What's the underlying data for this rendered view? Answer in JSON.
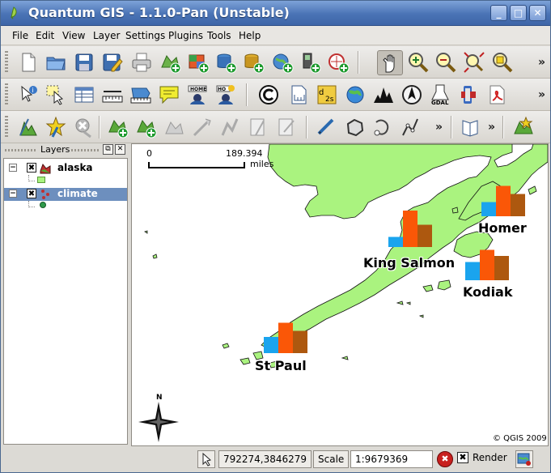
{
  "window": {
    "title": "Quantum GIS - 1.1.0-Pan (Unstable)",
    "minimize_glyph": "_",
    "maximize_glyph": "□",
    "close_glyph": "✕"
  },
  "menu": [
    "File",
    "Edit",
    "View",
    "Layer",
    "Settings",
    "Plugins",
    "Tools",
    "Help"
  ],
  "toolbar_overflow": "»",
  "toolbars": {
    "row1": [
      "new-project-icon",
      "open-project-icon",
      "save-project-icon",
      "save-as-icon",
      "print-icon",
      "add-vector-layer-icon",
      "add-raster-layer-icon",
      "add-postgis-layer-icon",
      "add-spatialite-layer-icon",
      "add-wms-layer-icon",
      "new-vector-layer-icon",
      "add-gps-layer-icon",
      "pan-icon",
      "zoom-in-icon",
      "zoom-out-icon",
      "zoom-full-icon",
      "zoom-selection-icon"
    ],
    "row2": [
      "identify-icon",
      "select-icon",
      "attribute-table-icon",
      "measure-line-icon",
      "measure-area-icon",
      "map-tips-icon",
      "new-bookmark-icon",
      "show-bookmarks-icon",
      "copyright-label-icon",
      "north-arrow-icon",
      "scale-bar-icon",
      "delimited-text-icon",
      "gps-tools-icon",
      "georeferencer-icon",
      "gdal-tools-icon",
      "python-console-icon",
      "help-pdf-icon"
    ],
    "row3": [
      "toggle-editing-icon",
      "capture-point-icon",
      "delete-feature-icon",
      "add-ring-icon",
      "add-island-icon",
      "split-feature-icon",
      "move-feature-icon",
      "reshape-icon",
      "cut-features-icon",
      "copy-features-icon",
      "paste-features-icon",
      "capture-line-icon",
      "capture-polygon-icon",
      "simplify-icon",
      "node-tool-icon",
      "help-icon",
      "legend-icon"
    ]
  },
  "layers_panel": {
    "title": "Layers",
    "float_glyph": "⧉",
    "close_glyph": "✕",
    "layers": [
      {
        "name": "alaska",
        "expanded": true,
        "selected": false,
        "checked": true
      },
      {
        "name": "climate",
        "expanded": true,
        "selected": true,
        "checked": true
      }
    ],
    "expander_glyph": "−",
    "check_glyph": "✖"
  },
  "map": {
    "colors": {
      "land": "#aaf37f",
      "sea": "#ffffff",
      "bar_blue": "#1aa4ee",
      "bar_orange": "#fa5707",
      "bar_brown": "#ad580f"
    },
    "scalebar": {
      "left_label": "0",
      "right_label": "189.394",
      "unit": "miles"
    },
    "labels": [
      "Homer",
      "King Salmon",
      "Kodiak",
      "St Paul"
    ],
    "north": "N",
    "copyright": "© QGIS 2009",
    "climate_bars": [
      {
        "city": "Homer",
        "values": [
          0.35,
          0.75,
          0.55
        ]
      },
      {
        "city": "King Salmon",
        "values": [
          0.25,
          0.9,
          0.55
        ]
      },
      {
        "city": "Kodiak",
        "values": [
          0.45,
          0.75,
          0.6
        ]
      },
      {
        "city": "St Paul",
        "values": [
          0.4,
          0.75,
          0.55
        ]
      }
    ]
  },
  "status": {
    "coords": "792274,3846279",
    "scale_label": "Scale",
    "scale_value": "1:9679369",
    "render_label": "Render",
    "render_checked": true,
    "stop_glyph": "✖"
  }
}
